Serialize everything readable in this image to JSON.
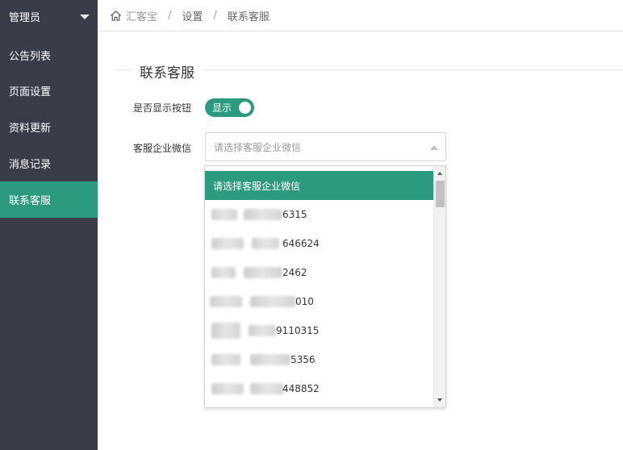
{
  "sidebar": {
    "header": "管理员",
    "items": [
      "公告列表",
      "页面设置",
      "资料更新",
      "消息记录",
      "联系客服"
    ],
    "active_index": 4
  },
  "breadcrumb": [
    "汇客宝",
    "设置",
    "联系客服"
  ],
  "section": {
    "title": "联系客服"
  },
  "form": {
    "show_button_label": "是否显示按钮",
    "toggle_label": "显示",
    "wechat_label": "客服企业微信",
    "select_placeholder": "请选择客服企业微信"
  },
  "dropdown": {
    "selected_option": "请选择客服企业微信",
    "options": [
      "6315",
      "646624",
      "2462",
      "010",
      "9110315",
      "5356",
      "448852"
    ]
  },
  "colors": {
    "accent": "#2b9a7f",
    "sidebar_bg": "#393d49"
  }
}
